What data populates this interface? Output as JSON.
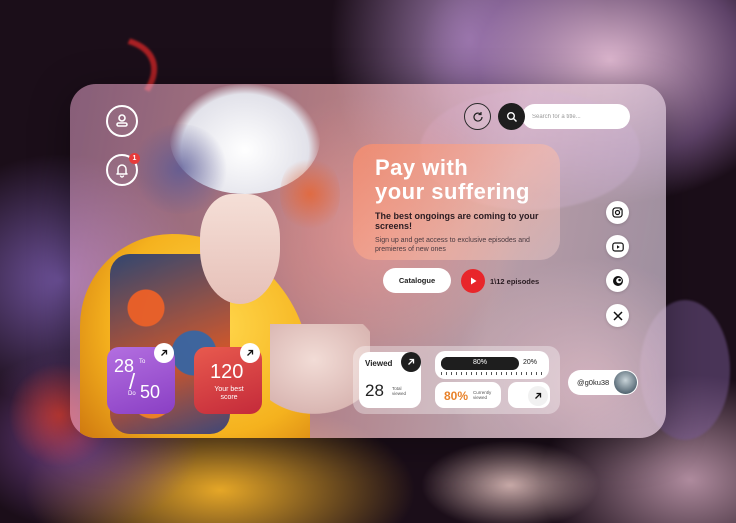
{
  "hero": {
    "title_line1": "Pay with",
    "title_line2": "your suffering",
    "subtitle": "The best ongoings are coming to your screens!",
    "description": "Sign up and get access to exclusive episodes and premieres of new ones"
  },
  "search": {
    "placeholder": "Search for a title..."
  },
  "notifications": {
    "count": "1"
  },
  "actions": {
    "catalogue_label": "Catalogue",
    "episodes_label": "1\\12 episodes"
  },
  "range_card": {
    "from_value": "28",
    "from_label": "To",
    "separator": "/",
    "to_label": "Do",
    "to_value": "50"
  },
  "score_card": {
    "value": "120",
    "label": "Your best score"
  },
  "viewed": {
    "title": "Viewed",
    "count": "28",
    "count_label": "Total viewed"
  },
  "progress": {
    "left_label": "80%",
    "right_label": "20%",
    "fill_fraction": 0.8
  },
  "percent_card": {
    "value": "80%",
    "label": "Currently viewed"
  },
  "user": {
    "handle": "@g0ku38"
  },
  "social": [
    "instagram-icon",
    "youtube-icon",
    "crunchyroll-icon",
    "x-icon"
  ],
  "colors": {
    "accent_red": "#e8262a",
    "purple_card": "#9b4fd0",
    "red_card": "#d83a3a",
    "dark": "#1e1e1e",
    "percent_orange": "#e8822a"
  }
}
